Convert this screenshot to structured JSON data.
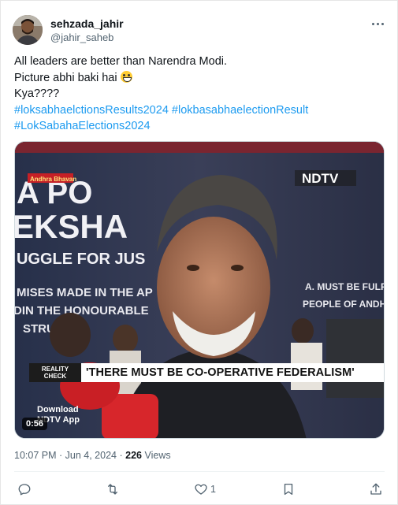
{
  "author": {
    "display_name": "sehzada_jahir",
    "handle": "@jahir_saheb",
    "avatar_icon": "profile-avatar"
  },
  "tweet": {
    "line1": "All leaders are better than Narendra Modi.",
    "line2": "Picture abhi baki hai",
    "line2_emoji": "grinning-face-emoji",
    "line3": "Kya????",
    "hashtag1": "#loksabhaelctionsResults2024",
    "hashtag2": "#lokbasabhaelectionResult",
    "hashtag3": "#LokSabahaElections2024"
  },
  "media": {
    "duration": "0:56",
    "channel_logo": "NDTV",
    "corner_label": "Andhra Bhavan",
    "ticker_badge_line1": "REALITY",
    "ticker_badge_line2": "CHECK",
    "ticker_headline": "'THERE MUST BE CO-OPERATIVE FEDERALISM'",
    "download_line1": "Download",
    "download_line2": "NDTV App",
    "banner_line1": "A PO",
    "banner_line2": "EKSHA",
    "banner_line3": "UGGLE FOR JUS",
    "banner_line4": "MISES MADE IN THE AP",
    "banner_line5": "DIN THE HONOURABLE",
    "banner_line6": "STRU",
    "banner_right1": "A. MUST BE FULFI",
    "banner_right2": "PEOPLE OF ANDHRA"
  },
  "meta": {
    "time": "10:07 PM",
    "separator": "·",
    "date": "Jun 4, 2024",
    "views_count": "226",
    "views_label": "Views"
  },
  "actions": {
    "reply_icon": "reply-icon",
    "retweet_icon": "retweet-icon",
    "like_icon": "heart-icon",
    "like_count": "1",
    "bookmark_icon": "bookmark-icon",
    "share_icon": "share-icon"
  },
  "colors": {
    "link": "#1d9bf0",
    "text": "#0f1419",
    "secondary": "#536471",
    "ndtv_red": "#d7262b"
  }
}
